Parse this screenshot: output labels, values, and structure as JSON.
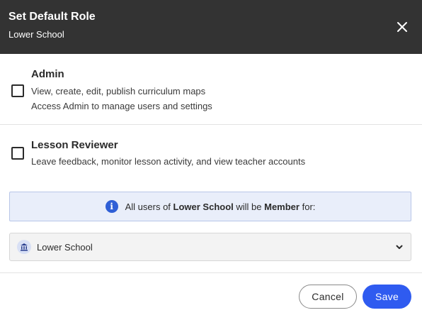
{
  "header": {
    "title": "Set Default Role",
    "subtitle": "Lower School",
    "close_icon": "close-icon"
  },
  "roles": [
    {
      "name": "Admin",
      "checked": false,
      "desc_lines": [
        "View, create, edit, publish curriculum maps",
        "Access Admin to manage users and settings"
      ]
    },
    {
      "name": "Lesson Reviewer",
      "checked": false,
      "desc_lines": [
        "Leave feedback, monitor lesson activity, and view teacher accounts"
      ]
    }
  ],
  "info": {
    "icon": "info-icon",
    "prefix": "All users of ",
    "school": "Lower School",
    "middle": " will be ",
    "role": "Member",
    "suffix": " for:"
  },
  "school_select": {
    "icon": "school-building-icon",
    "value": "Lower School"
  },
  "footer": {
    "cancel_label": "Cancel",
    "save_label": "Save"
  },
  "colors": {
    "header_bg": "#333333",
    "accent": "#2f5bf0",
    "info_bg": "#e9eefa"
  }
}
